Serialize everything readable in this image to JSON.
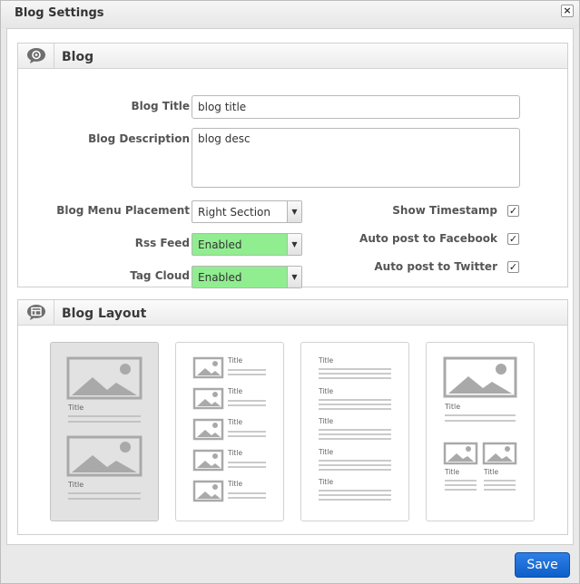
{
  "window": {
    "title": "Blog Settings",
    "close_glyph": "×"
  },
  "blog_section": {
    "title": "Blog",
    "icon": "speech-bubble-gear-icon",
    "fields": {
      "title_label": "Blog Title",
      "title_value": "blog title",
      "description_label": "Blog Description",
      "description_value": "blog desc",
      "menu_placement_label": "Blog Menu Placement",
      "menu_placement_value": "Right Section",
      "rss_label": "Rss Feed",
      "rss_value": "Enabled",
      "tag_cloud_label": "Tag Cloud",
      "tag_cloud_value": "Enabled"
    },
    "checkboxes": [
      {
        "label": "Show Timestamp",
        "checked": true
      },
      {
        "label": "Auto post to Facebook",
        "checked": true
      },
      {
        "label": "Auto post to Twitter",
        "checked": true
      }
    ],
    "check_glyph": "✓",
    "arrow_glyph": "▼",
    "select_highlight_color": "#90ee90"
  },
  "layout_section": {
    "title": "Blog Layout",
    "icon": "speech-bubble-layout-icon",
    "card_title_text": "Title",
    "selected_index": 0,
    "layouts": [
      "large-image-list",
      "thumbnail-list",
      "text-list",
      "featured-grid"
    ]
  },
  "footer": {
    "save_label": "Save",
    "save_color": "#1a6fdc"
  }
}
